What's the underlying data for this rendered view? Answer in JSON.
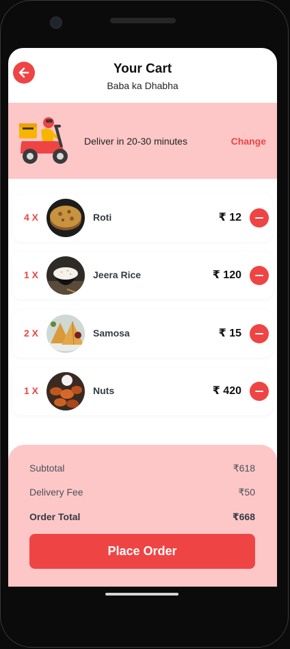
{
  "header": {
    "title": "Your Cart",
    "restaurant": "Baba ka Dhabha",
    "back_icon": "arrow-left-icon"
  },
  "delivery": {
    "text": "Deliver in 20-30 minutes",
    "change_label": "Change",
    "icon": "delivery-scooter-icon"
  },
  "items": [
    {
      "qty": "4 X",
      "name": "Roti",
      "price": "₹ 12"
    },
    {
      "qty": "1 X",
      "name": "Jeera Rice",
      "price": "₹ 120"
    },
    {
      "qty": "2 X",
      "name": "Samosa",
      "price": "₹ 15"
    },
    {
      "qty": "1 X",
      "name": "Nuts",
      "price": "₹ 420"
    }
  ],
  "summary": {
    "subtotal_label": "Subtotal",
    "subtotal_value": "₹618",
    "delivery_label": "Delivery Fee",
    "delivery_value": "₹50",
    "total_label": "Order Total",
    "total_value": "₹668",
    "place_order_label": "Place Order"
  },
  "colors": {
    "accent": "#ef4444",
    "accent_light": "#fdc7c7"
  }
}
